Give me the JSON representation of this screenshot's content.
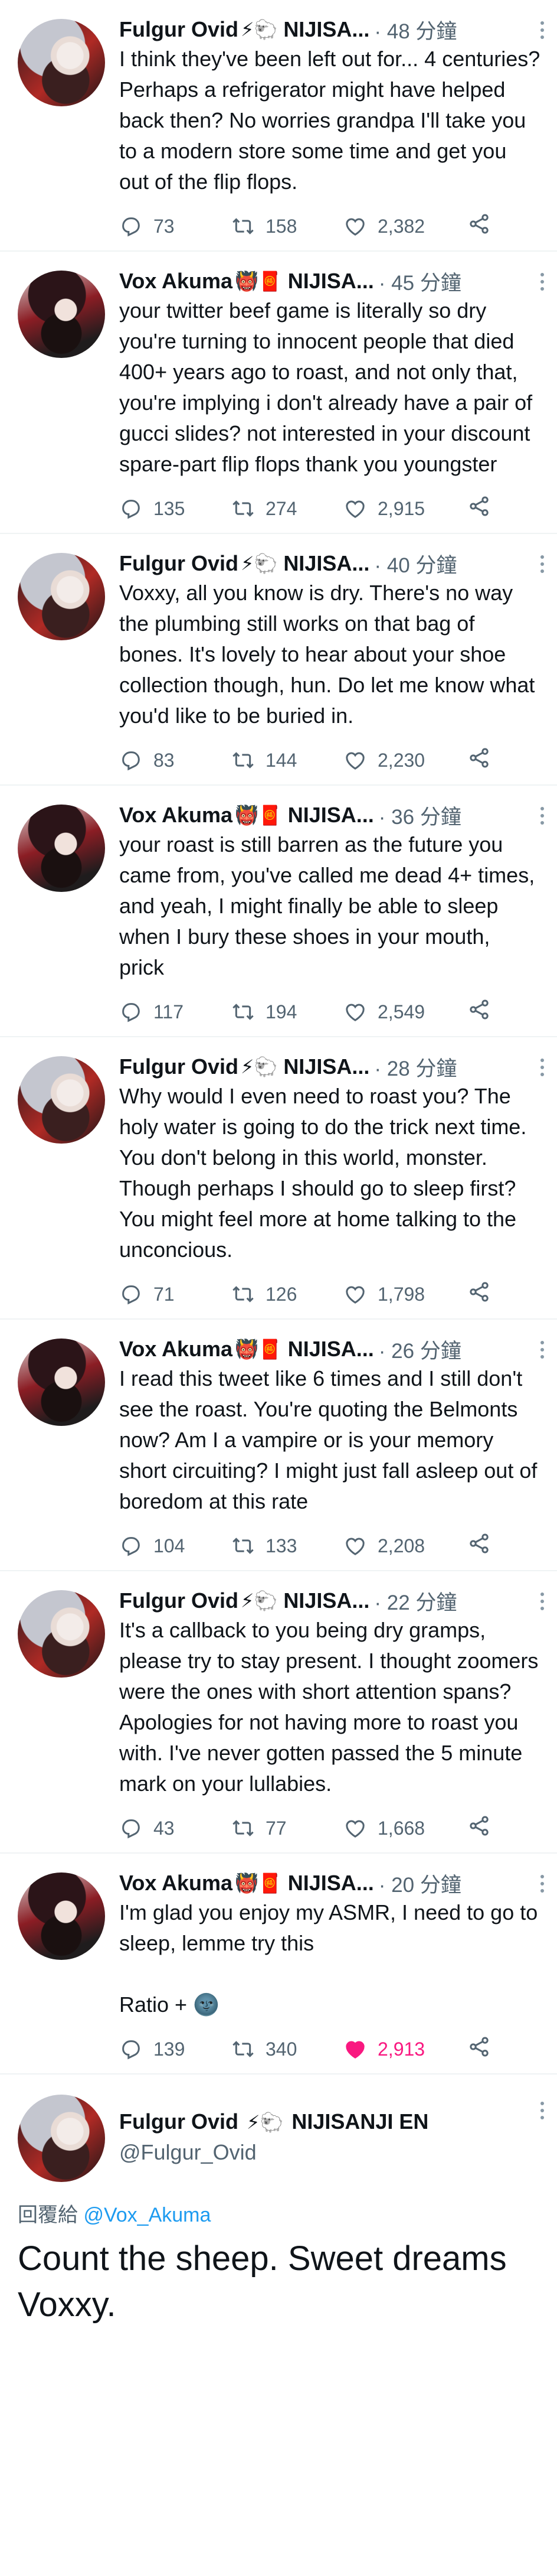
{
  "tweets": [
    {
      "author": "Fulgur Ovid",
      "emojis": "⚡🐑",
      "handle": "NIJISA...",
      "time": "· 48 分鐘",
      "text": "I think they've been left out for... 4 centuries? Perhaps a refrigerator might have helped back then? No worries grandpa I'll take you to a modern store some time and get you out of the flip flops.",
      "replies": "73",
      "retweets": "158",
      "likes": "2,382",
      "liked": false
    },
    {
      "author": "Vox Akuma",
      "emojis": "👹🧧",
      "handle": "NIJISA...",
      "time": "· 45 分鐘",
      "text": "your twitter beef game is literally so dry you're turning to innocent people that died 400+ years ago to roast, and not only that, you're implying i don't already have a pair of gucci slides? not interested in your discount spare-part flip flops thank you youngster",
      "replies": "135",
      "retweets": "274",
      "likes": "2,915",
      "liked": false
    },
    {
      "author": "Fulgur Ovid",
      "emojis": "⚡🐑",
      "handle": "NIJISA...",
      "time": "· 40 分鐘",
      "text": "Voxxy, all you know is dry. There's no way the plumbing still works on that bag of bones. It's lovely to hear about your shoe collection though, hun. Do let me know what you'd like to be buried in.",
      "replies": "83",
      "retweets": "144",
      "likes": "2,230",
      "liked": false
    },
    {
      "author": "Vox Akuma",
      "emojis": "👹🧧",
      "handle": "NIJISA...",
      "time": "· 36 分鐘",
      "text": "your roast is still barren as the future you came from, you've called me dead 4+ times, and yeah, I might finally be able to sleep when I bury these shoes in your mouth, prick",
      "replies": "117",
      "retweets": "194",
      "likes": "2,549",
      "liked": false
    },
    {
      "author": "Fulgur Ovid",
      "emojis": "⚡🐑",
      "handle": "NIJISA...",
      "time": "· 28 分鐘",
      "text": "Why would I even need to roast you? The holy water is going to do the trick next time. You don't belong in this world, monster. Though perhaps I should go to sleep first? You might feel more at home talking to the unconcious.",
      "replies": "71",
      "retweets": "126",
      "likes": "1,798",
      "liked": false
    },
    {
      "author": "Vox Akuma",
      "emojis": "👹🧧",
      "handle": "NIJISA...",
      "time": "· 26 分鐘",
      "text": "I read this tweet like 6 times and I still don't see the roast. You're quoting the Belmonts now? Am I a vampire or is your memory short circuiting? I might just fall asleep out of boredom at this rate",
      "replies": "104",
      "retweets": "133",
      "likes": "2,208",
      "liked": false
    },
    {
      "author": "Fulgur Ovid",
      "emojis": "⚡🐑",
      "handle": "NIJISA...",
      "time": "· 22 分鐘",
      "text": "It's a callback to you being dry gramps, please try to stay present. I thought zoomers were the ones with short attention spans? Apologies for not having more to roast you with. I've never gotten passed the 5 minute mark on your lullabies.",
      "replies": "43",
      "retweets": "77",
      "likes": "1,668",
      "liked": false
    },
    {
      "author": "Vox Akuma",
      "emojis": "👹🧧",
      "handle": "NIJISA...",
      "time": "· 20 分鐘",
      "text": "I'm glad you enjoy my ASMR, I need to go to sleep, lemme try this\n\nRatio + 🌚",
      "replies": "139",
      "retweets": "340",
      "likes": "2,913",
      "liked": true
    }
  ],
  "main_tweet": {
    "author": "Fulgur Ovid",
    "emojis": "⚡🐑",
    "org": "NIJISANJI EN",
    "handle": "@Fulgur_Ovid",
    "reply_prefix": "回覆給 ",
    "reply_to": "@Vox_Akuma",
    "text": "Count the sheep. Sweet dreams Voxxy."
  },
  "colors": {
    "like_active": "#f91880",
    "link": "#1d9bf0",
    "muted": "#536471"
  }
}
